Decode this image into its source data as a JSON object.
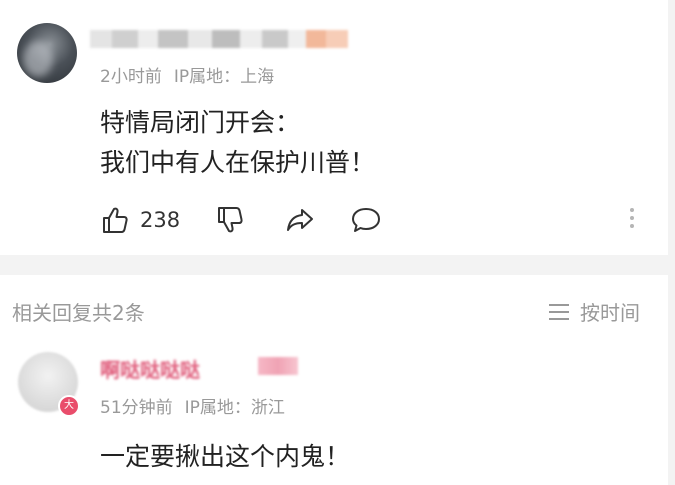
{
  "comment": {
    "username": "",
    "time": "2小时前",
    "ip_label": "IP属地：上海",
    "text_line1": "特情局闭门开会：",
    "text_line2": "我们中有人在保护川普！",
    "like_count": "238"
  },
  "replies_section": {
    "header": "相关回复共2条",
    "sort_label": "按时间"
  },
  "reply": {
    "username": "啊哒哒哒哒",
    "badge": "大",
    "time": "51分钟前",
    "ip_label": "IP属地：浙江",
    "text": "一定要揪出这个内鬼！"
  },
  "colors": {
    "page_bg": "#f3f3f3",
    "card_bg": "#ffffff",
    "meta_text": "#999999",
    "body_text": "#222222",
    "reply_name": "#e0607e",
    "badge": "#e94d6b"
  },
  "icons": [
    "thumbs-up-icon",
    "thumbs-down-icon",
    "share-icon",
    "comment-icon",
    "more-vertical-icon",
    "sort-lines-icon"
  ]
}
